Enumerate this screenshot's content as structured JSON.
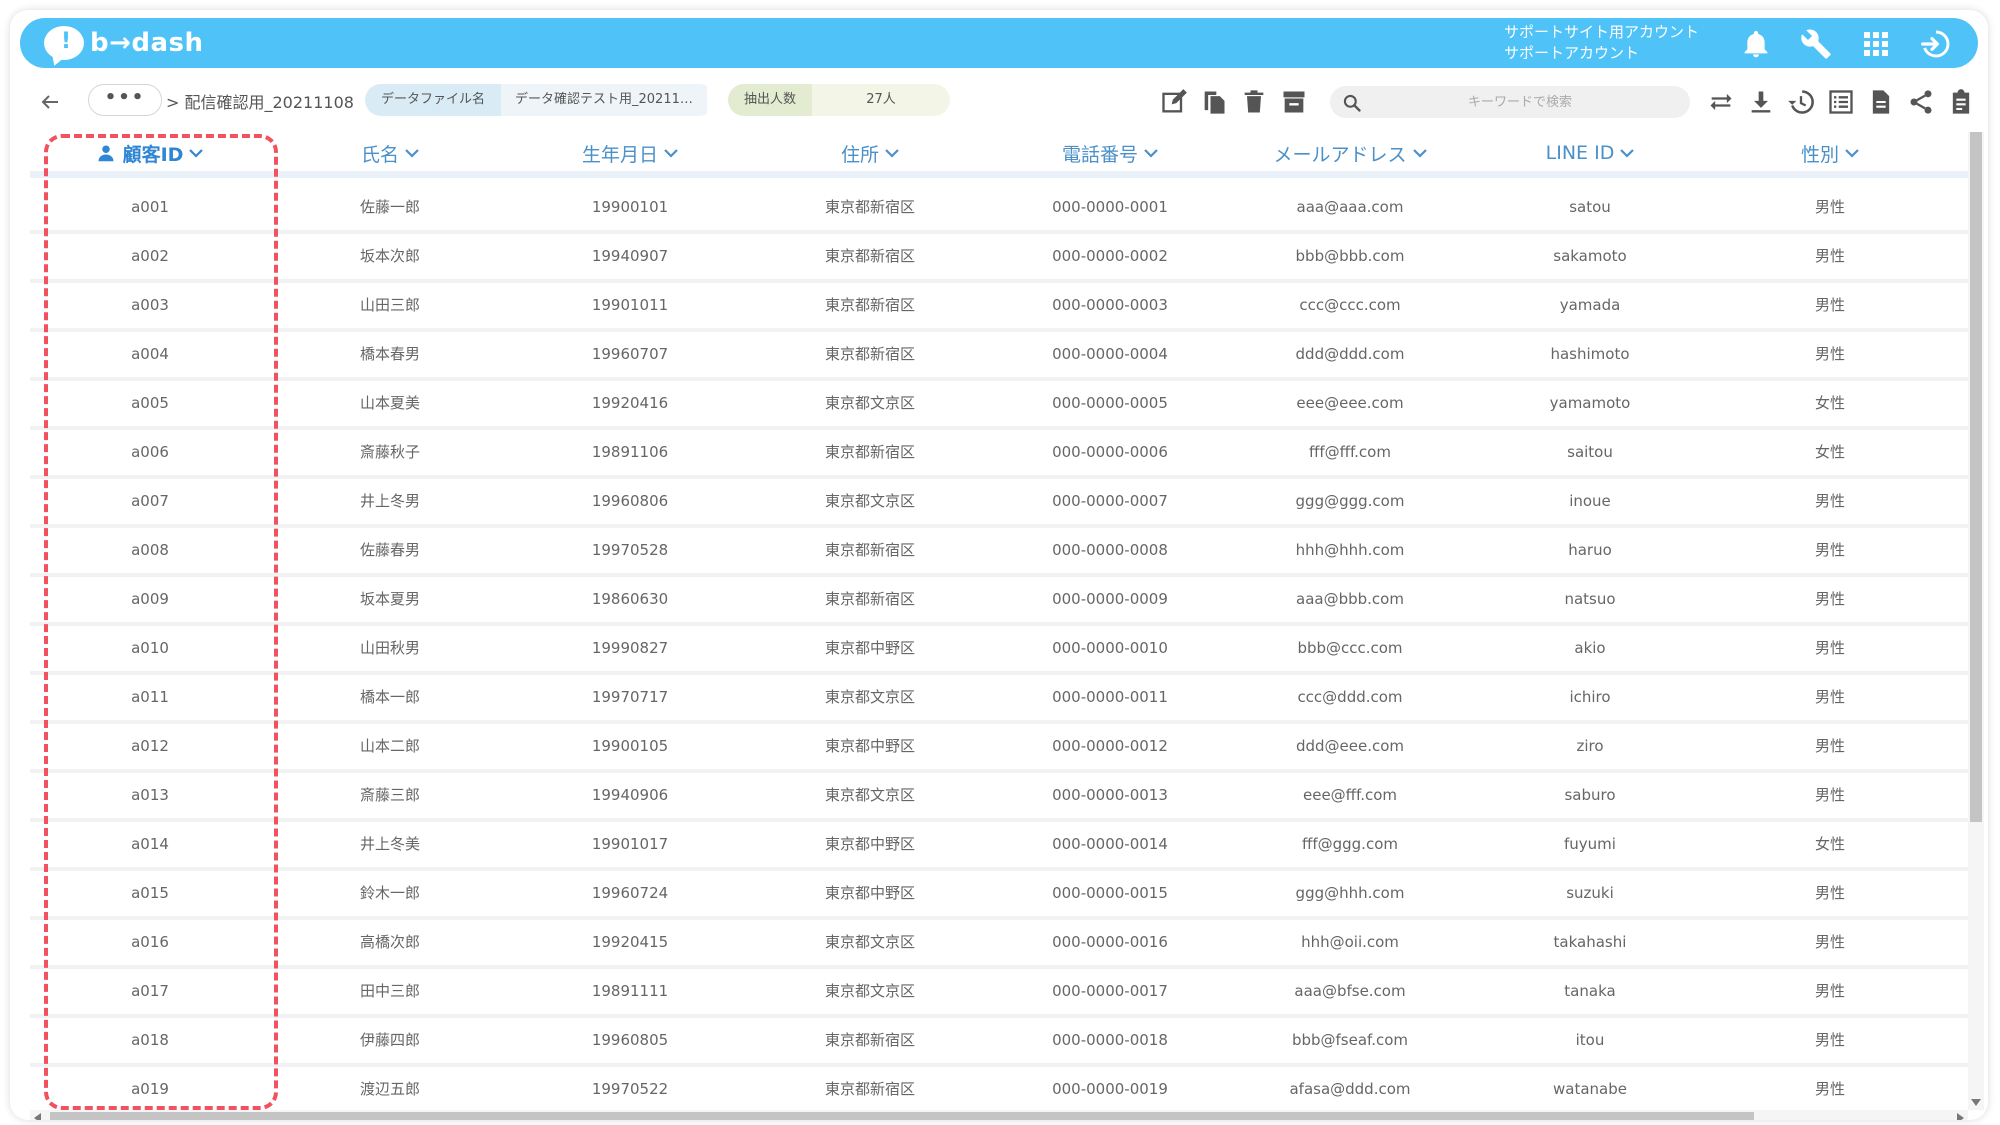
{
  "app": {
    "logo_text": "b→dash",
    "account_line1": "サポートサイト用アカウント",
    "account_line2": "サポートアカウント"
  },
  "toolbar": {
    "more_label": "•••",
    "breadcrumb": "> 配信確認用_20211108",
    "datafile_key": "データファイル名",
    "datafile_value": "データ確認テスト用_20211…",
    "count_key": "抽出人数",
    "count_value": "27人",
    "search_placeholder": "キーワードで検索"
  },
  "table": {
    "columns": [
      "顧客ID",
      "氏名",
      "生年月日",
      "住所",
      "電話番号",
      "メールアドレス",
      "LINE ID",
      "性別"
    ],
    "rows": [
      [
        "a001",
        "佐藤一郎",
        "19900101",
        "東京都新宿区",
        "000-0000-0001",
        "aaa@aaa.com",
        "satou",
        "男性"
      ],
      [
        "a002",
        "坂本次郎",
        "19940907",
        "東京都新宿区",
        "000-0000-0002",
        "bbb@bbb.com",
        "sakamoto",
        "男性"
      ],
      [
        "a003",
        "山田三郎",
        "19901011",
        "東京都新宿区",
        "000-0000-0003",
        "ccc@ccc.com",
        "yamada",
        "男性"
      ],
      [
        "a004",
        "橋本春男",
        "19960707",
        "東京都新宿区",
        "000-0000-0004",
        "ddd@ddd.com",
        "hashimoto",
        "男性"
      ],
      [
        "a005",
        "山本夏美",
        "19920416",
        "東京都文京区",
        "000-0000-0005",
        "eee@eee.com",
        "yamamoto",
        "女性"
      ],
      [
        "a006",
        "斎藤秋子",
        "19891106",
        "東京都新宿区",
        "000-0000-0006",
        "fff@fff.com",
        "saitou",
        "女性"
      ],
      [
        "a007",
        "井上冬男",
        "19960806",
        "東京都文京区",
        "000-0000-0007",
        "ggg@ggg.com",
        "inoue",
        "男性"
      ],
      [
        "a008",
        "佐藤春男",
        "19970528",
        "東京都新宿区",
        "000-0000-0008",
        "hhh@hhh.com",
        "haruo",
        "男性"
      ],
      [
        "a009",
        "坂本夏男",
        "19860630",
        "東京都新宿区",
        "000-0000-0009",
        "aaa@bbb.com",
        "natsuo",
        "男性"
      ],
      [
        "a010",
        "山田秋男",
        "19990827",
        "東京都中野区",
        "000-0000-0010",
        "bbb@ccc.com",
        "akio",
        "男性"
      ],
      [
        "a011",
        "橋本一郎",
        "19970717",
        "東京都文京区",
        "000-0000-0011",
        "ccc@ddd.com",
        "ichiro",
        "男性"
      ],
      [
        "a012",
        "山本二郎",
        "19900105",
        "東京都中野区",
        "000-0000-0012",
        "ddd@eee.com",
        "ziro",
        "男性"
      ],
      [
        "a013",
        "斎藤三郎",
        "19940906",
        "東京都文京区",
        "000-0000-0013",
        "eee@fff.com",
        "saburo",
        "男性"
      ],
      [
        "a014",
        "井上冬美",
        "19901017",
        "東京都中野区",
        "000-0000-0014",
        "fff@ggg.com",
        "fuyumi",
        "女性"
      ],
      [
        "a015",
        "鈴木一郎",
        "19960724",
        "東京都中野区",
        "000-0000-0015",
        "ggg@hhh.com",
        "suzuki",
        "男性"
      ],
      [
        "a016",
        "高橋次郎",
        "19920415",
        "東京都文京区",
        "000-0000-0016",
        "hhh@oii.com",
        "takahashi",
        "男性"
      ],
      [
        "a017",
        "田中三郎",
        "19891111",
        "東京都文京区",
        "000-0000-0017",
        "aaa@bfse.com",
        "tanaka",
        "男性"
      ],
      [
        "a018",
        "伊藤四郎",
        "19960805",
        "東京都新宿区",
        "000-0000-0018",
        "bbb@fseaf.com",
        "itou",
        "男性"
      ],
      [
        "a019",
        "渡辺五郎",
        "19970522",
        "東京都新宿区",
        "000-0000-0019",
        "afasa@ddd.com",
        "watanabe",
        "男性"
      ]
    ]
  },
  "colors": {
    "header_bg": "#4fc3f7",
    "column_header_text": "#4a90c9",
    "highlight_border": "#f0525f"
  },
  "icons": {
    "header": [
      "bell-icon",
      "wrench-icon",
      "apps-grid-icon",
      "logout-icon"
    ],
    "toolbar": [
      "edit-icon",
      "copy-icon",
      "trash-icon",
      "archive-icon",
      "sync-icon",
      "download-icon",
      "history-icon",
      "list-icon",
      "document-icon",
      "share-icon",
      "clipboard-icon"
    ]
  }
}
